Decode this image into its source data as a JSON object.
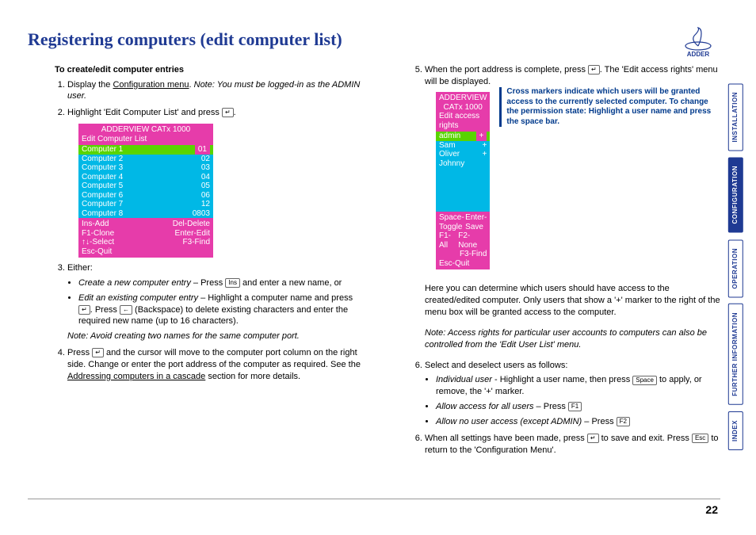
{
  "title": "Registering computers (edit computer list)",
  "subhead": "To create/edit computer entries",
  "step1_a": "Display the ",
  "step1_link": "Configuration menu",
  "step1_b": ". ",
  "step1_note": "Note: You must be logged-in as the ADMIN user.",
  "step2_a": "Highlight 'Edit Computer List' and press ",
  "step2_key": "↵",
  "step2_b": ".",
  "osd1": {
    "title": "ADDERVIEW CATx 1000",
    "sub": "Edit Computer List",
    "rows": [
      [
        "Computer 1",
        "01"
      ],
      [
        "Computer 2",
        "02"
      ],
      [
        "Computer 3",
        "03"
      ],
      [
        "Computer 4",
        "04"
      ],
      [
        "Computer 5",
        "05"
      ],
      [
        "Computer 6",
        "06"
      ],
      [
        "Computer 7",
        "12"
      ],
      [
        "Computer 8",
        "0803"
      ]
    ],
    "ftr": [
      [
        "Ins-Add",
        "Del-Delete"
      ],
      [
        "F1-Clone",
        "Enter-Edit"
      ],
      [
        "↑↓-Select",
        "F3-Find"
      ],
      [
        "Esc-Quit",
        ""
      ]
    ]
  },
  "step3": "Either:",
  "step3a_em": "Create a new computer entry",
  "step3a_txt": " – Press ",
  "step3a_key": "Ins",
  "step3a_end": " and enter a new name, or",
  "step3b_em": "Edit an existing computer entry",
  "step3b_txt": " – Highlight a computer name and press ",
  "step3b_key1": "↵",
  "step3b_mid": ". Press ",
  "step3b_key2": "←",
  "step3b_end": " (Backspace) to delete existing characters and enter the required new name (up to 16 characters).",
  "step3_note": "Note: Avoid creating two names for the same computer port.",
  "step4_a": "Press ",
  "step4_key": "↵",
  "step4_b": " and the cursor will move to the computer port column on the right side. Change or enter the port address of the computer as required. See the ",
  "step4_link": "Addressing computers in a cascade",
  "step4_c": " section for more details.",
  "step5_a": "When the port address is complete, press ",
  "step5_key": "↵",
  "step5_b": ". The 'Edit access rights' menu will be displayed.",
  "osd2": {
    "title": "ADDERVIEW CATx 1000",
    "sub": "Edit access rights",
    "rows": [
      [
        "admin",
        "+"
      ],
      [
        "Sam",
        "+"
      ],
      [
        "Oliver",
        "+"
      ],
      [
        "Johnny",
        ""
      ]
    ],
    "ftr": [
      [
        "Space-Toggle",
        "Enter-Save"
      ],
      [
        "F1-All",
        "F2-None"
      ],
      [
        "",
        "F3-Find"
      ],
      [
        "Esc-Quit",
        ""
      ]
    ]
  },
  "callout": "Cross markers indicate which users will be granted access to the currently selected computer. To change the permission state: Highlight a user name and press the space bar.",
  "par5_a": "Here you can determine which users should have access to the created/edited computer. Only users that show a '+' marker to the right of the menu box will be granted access to the computer.",
  "par5_note": "Note: Access rights for particular user accounts to computers can also be controlled from the 'Edit User List' menu.",
  "step6": "Select and deselect users as follows:",
  "s6a_em": "Individual user",
  "s6a_txt": " - Highlight a user name, then press ",
  "s6a_key": "Space",
  "s6a_end": " to apply, or remove, the '+' marker.",
  "s6b_em": "Allow access for all users",
  "s6b_txt": " – Press ",
  "s6b_key": "F1",
  "s6c_em": "Allow no user access (except ADMIN)",
  "s6c_txt": " – Press ",
  "s6c_key": "F2",
  "step6b_a": "When all settings have been made, press ",
  "step6b_key1": "↵",
  "step6b_b": " to save and exit. Press ",
  "step6b_key2": "Esc",
  "step6b_c": " to return to the 'Configuration Menu'.",
  "logo": "ADDER",
  "tabs": [
    "INSTALLATION",
    "CONFIGURATION",
    "OPERATION",
    "FURTHER INFORMATION",
    "INDEX"
  ],
  "pagenum": "22"
}
